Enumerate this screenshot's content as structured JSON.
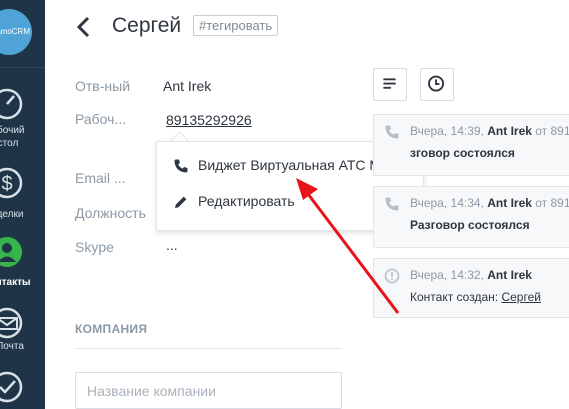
{
  "sidebar": {
    "logo_text": "amoCRM",
    "items": [
      {
        "label": "абочий стол",
        "icon": "dashboard-icon"
      },
      {
        "label": "делки",
        "icon": "dollar-icon"
      },
      {
        "label": "онтакты",
        "icon": "contacts-icon",
        "active": true
      },
      {
        "label": "Почта",
        "icon": "mail-icon"
      },
      {
        "label": "",
        "icon": "tasks-icon"
      }
    ]
  },
  "header": {
    "title": "Сергей",
    "tag_label": "#тегировать"
  },
  "fields": {
    "responsible_label": "Отв-ный",
    "responsible_value": "Ant Irek",
    "work_label": "Рабоч...",
    "work_value": "89135292926",
    "email_label": "Email ...",
    "position_label": "Должность",
    "skype_label": "Skype",
    "skype_value": "..."
  },
  "company": {
    "section_title": "КОМПАНИЯ",
    "input_placeholder": "Название компании"
  },
  "popup": {
    "items": [
      {
        "label": "Виджет Виртуальная АТС Мобилон",
        "icon": "phone-icon"
      },
      {
        "label": "Редактировать",
        "icon": "pencil-icon"
      }
    ]
  },
  "feed": {
    "buttons": [
      {
        "icon": "notes-icon"
      },
      {
        "icon": "clock-icon"
      }
    ],
    "cards": [
      {
        "meta_prefix": "Вчера, 14:39, ",
        "author": "Ant Irek",
        "meta_suffix": " от 891",
        "text": "зговор состоялся"
      },
      {
        "meta_prefix": "Вчера, 14:34, ",
        "author": "Ant Irek",
        "meta_suffix": " от 891",
        "text": "Разговор состоялся"
      },
      {
        "meta_prefix": "Вчера, 14:32, ",
        "author": "Ant Irek",
        "meta_suffix": "",
        "text_prefix": "Контакт создан: ",
        "text_link": "Сергей"
      }
    ]
  },
  "colors": {
    "sidebar": "#1f3547",
    "accent_arrow": "#e8121a",
    "logo": "#4fa3d6"
  }
}
